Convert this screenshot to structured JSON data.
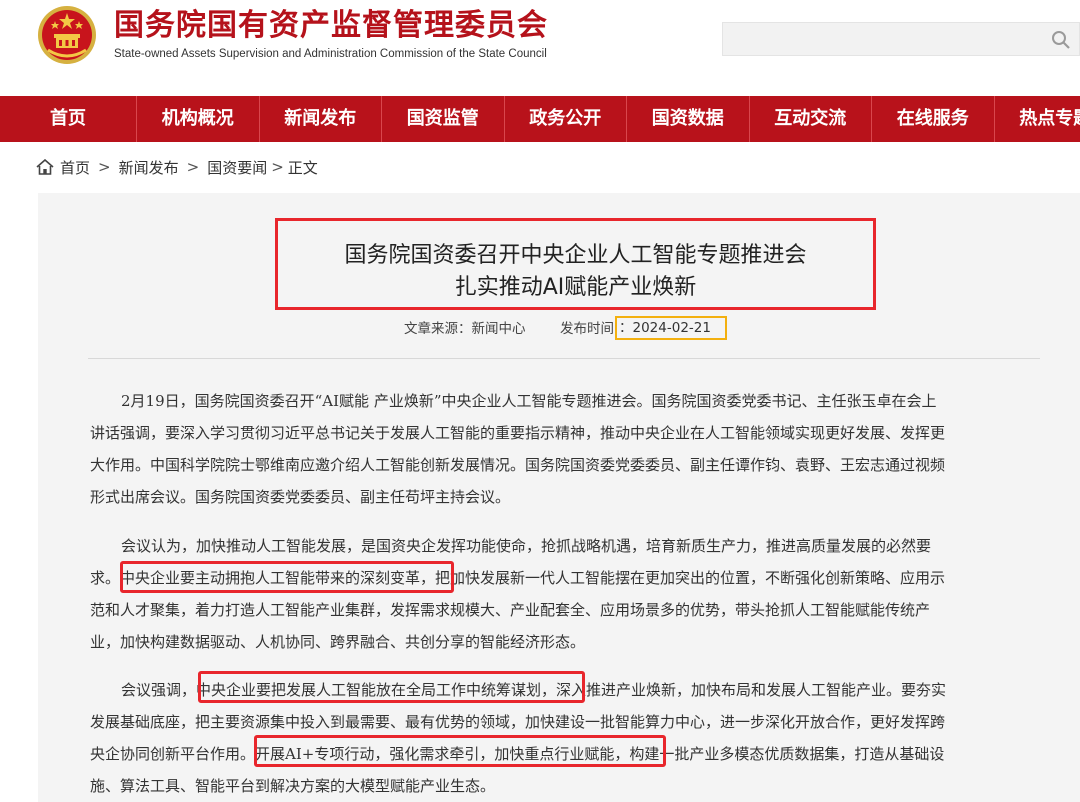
{
  "header": {
    "title": "国务院国有资产监督管理委员会",
    "subtitle": "State-owned Assets Supervision and Administration Commission of the State Council",
    "search_placeholder": ""
  },
  "nav": {
    "items": [
      "首页",
      "机构概况",
      "新闻发布",
      "国资监管",
      "政务公开",
      "国资数据",
      "互动交流",
      "在线服务",
      "热点专题"
    ]
  },
  "breadcrumb": {
    "home": "首页",
    "sep1": ">",
    "level1": "新闻发布",
    "sep2": ">",
    "level2": "国资要闻",
    "sep3": ">",
    "current": "正文"
  },
  "article": {
    "title_line1": "国务院国资委召开中央企业人工智能专题推进会",
    "title_line2": "扎实推动AI赋能产业焕新",
    "source": "文章来源：新闻中心",
    "date_label": "发布时间",
    "date_value": "：2024-02-21",
    "paragraphs": [
      [
        "2月19日，国务院国资委召开“AI赋能 产业焕新”中央企业人工智能专题推进会。国务院国资委党委书记、主任张玉卓在会上",
        "讲话强调，要深入学习贯彻习近平总书记关于发展人工智能的重要指示精神，推动中央企业在人工智能领域实现更好发展、发挥更",
        "大作用。中国科学院院士鄂维南应邀介绍人工智能创新发展情况。国务院国资委党委委员、副主任谭作钧、袁野、王宏志通过视频",
        "形式出席会议。国务院国资委党委委员、副主任苟坪主持会议。"
      ],
      [
        "会议认为，加快推动人工智能发展，是国资央企发挥功能使命，抢抓战略机遇，培育新质生产力，推进高质量发展的必然要",
        "求。中央企业要主动拥抱人工智能带来的深刻变革，把加快发展新一代人工智能摆在更加突出的位置，不断强化创新策略、应用示",
        "范和人才聚集，着力打造人工智能产业集群，发挥需求规模大、产业配套全、应用场景多的优势，带头抢抓人工智能赋能传统产",
        "业，加快构建数据驱动、人机协同、跨界融合、共创分享的智能经济形态。"
      ],
      [
        "会议强调，中央企业要把发展人工智能放在全局工作中统筹谋划，深入推进产业焕新，加快布局和发展人工智能产业。要夯实",
        "发展基础底座，把主要资源集中投入到最需要、最有优势的领域，加快建设一批智能算力中心，进一步深化开放合作，更好发挥跨",
        "央企协同创新平台作用。开展AI+专项行动，强化需求牵引，加快重点行业赋能，构建一批产业多模态优质数据集，打造从基础设",
        "施、算法工具、智能平台到解决方案的大模型赋能产业生态。"
      ]
    ]
  },
  "colors": {
    "brand_red": "#b8121b",
    "highlight_red": "#e8262c",
    "highlight_yellow": "#f3b00f"
  }
}
